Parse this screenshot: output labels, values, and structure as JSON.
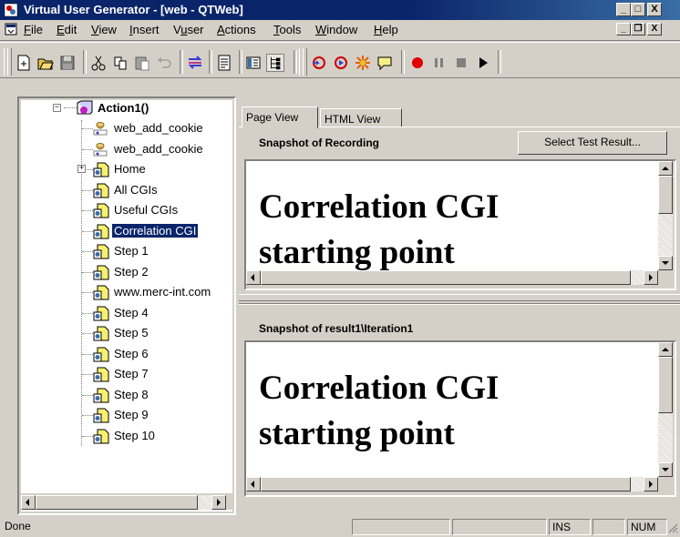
{
  "window": {
    "title": "Virtual User Generator - [web - QTWeb]",
    "controls": {
      "minimize": "_",
      "maximize": "□",
      "close": "X"
    }
  },
  "menubar": {
    "items": [
      {
        "label": "File",
        "accel": "F"
      },
      {
        "label": "Edit",
        "accel": "E"
      },
      {
        "label": "View",
        "accel": "V"
      },
      {
        "label": "Insert",
        "accel": "I"
      },
      {
        "label": "Vuser",
        "accel": "u"
      },
      {
        "label": "Actions",
        "accel": "A"
      },
      {
        "label": "Tools",
        "accel": "T"
      },
      {
        "label": "Window",
        "accel": "W"
      },
      {
        "label": "Help",
        "accel": "H"
      }
    ],
    "mdi_controls": {
      "minimize": "_",
      "restore": "❐",
      "close": "X"
    }
  },
  "toolbar": {
    "buttons": [
      "new-icon",
      "open-icon",
      "save-icon",
      "cut-icon",
      "copy-icon",
      "paste-icon",
      "undo-icon",
      "compile-icon",
      "script-view-icon",
      "tree-view-pane-icon",
      "tree-view-icon",
      "record-into-action-icon",
      "run-step-icon",
      "insert-transaction-icon",
      "comment-icon",
      "record-icon",
      "pause-icon",
      "stop-icon",
      "run-icon"
    ]
  },
  "tree": {
    "root": {
      "label": "Action1()"
    },
    "items": [
      {
        "label": "web_add_cookie",
        "icon": "cookie-icon",
        "expander": false
      },
      {
        "label": "web_add_cookie",
        "icon": "cookie-icon",
        "expander": false
      },
      {
        "label": "Home",
        "icon": "page-icon",
        "expander": true
      },
      {
        "label": "All CGIs",
        "icon": "page-icon",
        "expander": false
      },
      {
        "label": "Useful CGIs",
        "icon": "page-icon",
        "expander": false
      },
      {
        "label": "Correlation CGI",
        "icon": "page-icon",
        "expander": false,
        "selected": true
      },
      {
        "label": "Step 1",
        "icon": "page-icon",
        "expander": false
      },
      {
        "label": "Step 2",
        "icon": "page-icon",
        "expander": false
      },
      {
        "label": "www.merc-int.com",
        "icon": "page-icon",
        "expander": false
      },
      {
        "label": "Step 4",
        "icon": "page-icon",
        "expander": false
      },
      {
        "label": "Step 5",
        "icon": "page-icon",
        "expander": false
      },
      {
        "label": "Step 6",
        "icon": "page-icon",
        "expander": false
      },
      {
        "label": "Step 7",
        "icon": "page-icon",
        "expander": false
      },
      {
        "label": "Step 8",
        "icon": "page-icon",
        "expander": false
      },
      {
        "label": "Step 9",
        "icon": "page-icon",
        "expander": false
      },
      {
        "label": "Step 10",
        "icon": "page-icon",
        "expander": false
      }
    ]
  },
  "tabs": [
    {
      "label": "Page View",
      "active": true
    },
    {
      "label": "HTML View",
      "active": false
    }
  ],
  "recording_pane": {
    "heading": "Snapshot of Recording",
    "button": "Select Test Result...",
    "content_line1": "Correlation CGI",
    "content_line2": "starting point"
  },
  "result_pane": {
    "heading": "Snapshot of result1\\Iteration1",
    "content_line1": "Correlation CGI",
    "content_line2": "starting point"
  },
  "statusbar": {
    "text": "Done",
    "ins": "INS",
    "num": "NUM"
  },
  "colors": {
    "titlebar": "#0a246a",
    "face": "#d4d0c8",
    "selection": "#0a246a"
  }
}
